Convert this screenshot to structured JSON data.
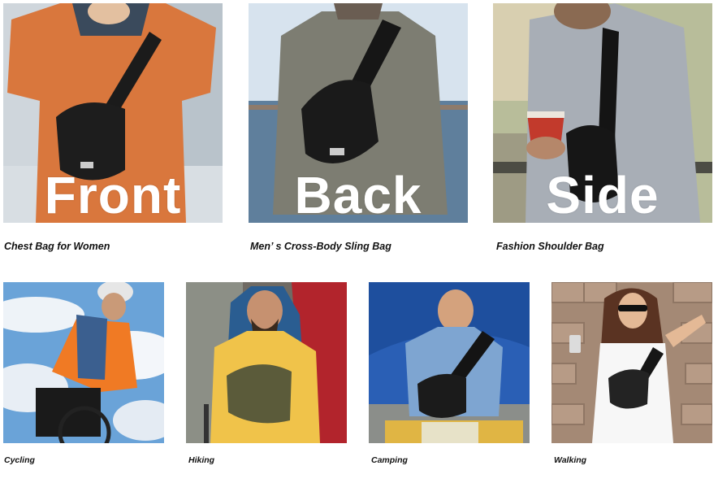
{
  "top_row": [
    {
      "overlay": "Front",
      "caption": "Chest Bag for Women"
    },
    {
      "overlay": "Back",
      "caption": "Men’ s Cross-Body Sling Bag"
    },
    {
      "overlay": "Side",
      "caption": "Fashion Shoulder Bag"
    }
  ],
  "bottom_row": [
    {
      "caption": "Cycling"
    },
    {
      "caption": "Hiking"
    },
    {
      "caption": "Camping"
    },
    {
      "caption": "Walking"
    }
  ]
}
